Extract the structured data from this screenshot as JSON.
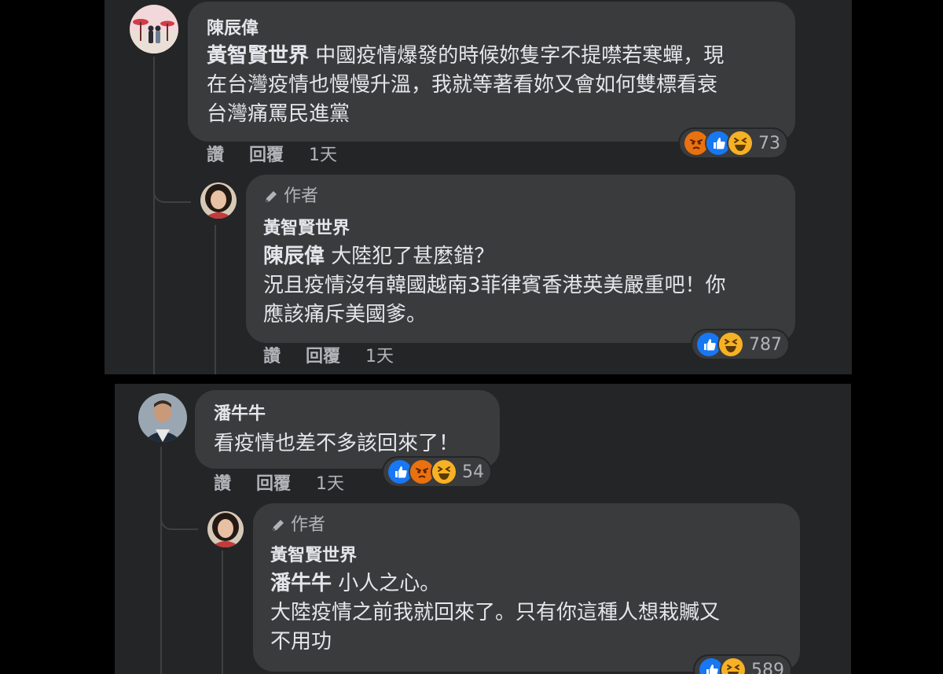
{
  "comments": [
    {
      "author": "陳辰偉",
      "mention": "黃智賢世界",
      "lines": [
        " 中國疫情爆發的時候妳隻字不提噤若寒蟬，現",
        "在台灣疫情也慢慢升溫，我就等著看妳又會如何雙標看衰",
        "台灣痛罵民進黨"
      ],
      "reactions": [
        "angry",
        "like",
        "haha"
      ],
      "reaction_count": "73",
      "actions": {
        "like": "讚",
        "reply": "回覆",
        "time": "1天"
      },
      "reply": {
        "badge": "作者",
        "author": "黃智賢世界",
        "mention": "陳辰偉",
        "lines": [
          " 大陸犯了甚麼錯？",
          "況且疫情沒有韓國越南3菲律賓香港英美嚴重吧！你",
          "應該痛斥美國爹。"
        ],
        "reactions": [
          "like",
          "haha"
        ],
        "reaction_count": "787",
        "actions": {
          "like": "讚",
          "reply": "回覆",
          "time": "1天"
        }
      }
    },
    {
      "author": "潘牛牛",
      "lines": [
        "看疫情也差不多該回來了！"
      ],
      "reactions": [
        "like",
        "angry",
        "haha"
      ],
      "reaction_count": "54",
      "actions": {
        "like": "讚",
        "reply": "回覆",
        "time": "1天"
      },
      "reply": {
        "badge": "作者",
        "author": "黃智賢世界",
        "mention": "潘牛牛",
        "lines": [
          " 小人之心。",
          "大陸疫情之前我就回來了。只有你這種人想栽贓又",
          "不用功"
        ],
        "reactions": [
          "like",
          "haha"
        ],
        "reaction_count": "589"
      }
    }
  ],
  "colors": {
    "background": "#242526",
    "bubble": "#3a3b3c",
    "text": "#e4e6eb",
    "secondary_text": "#b0b3b8",
    "like": "#1877f2",
    "haha": "#f7b125",
    "angry": "#e9710f"
  },
  "icons": {
    "badge": "pencil-icon",
    "like": "like-reaction-icon",
    "haha": "haha-reaction-icon",
    "angry": "angry-reaction-icon"
  }
}
